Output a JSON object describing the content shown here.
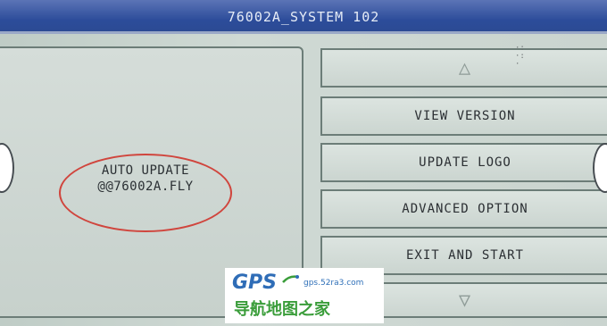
{
  "window": {
    "title": "76002A_SYSTEM 102"
  },
  "status": {
    "line1": "AUTO UPDATE",
    "line2": "@@76002A.FLY"
  },
  "buttons": {
    "up_arrow": "△",
    "view_version": "VIEW VERSION",
    "update_logo": "UPDATE LOGO",
    "advanced_option": "ADVANCED OPTION",
    "exit_and_start": "EXIT AND START",
    "down_arrow": "▽"
  },
  "watermark": {
    "brand": "GPS",
    "url": "gps.52ra3.com",
    "chinese": "导航地图之家"
  },
  "colors": {
    "title_bar": "#2c4c9a",
    "highlight_circle": "#d0453d"
  }
}
